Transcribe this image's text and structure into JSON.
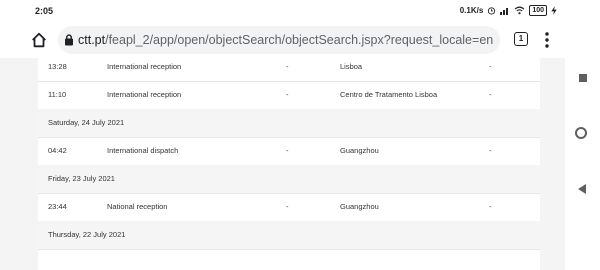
{
  "status_bar": {
    "time": "2:05",
    "net_speed": "0.1K/s",
    "battery": "100"
  },
  "browser": {
    "url_domain": "ctt.pt",
    "url_path": "/feapl_2/app/open/objectSearch/objectSearch.jspx?request_locale=en",
    "tab_count": "1"
  },
  "tracking": {
    "rows": [
      {
        "type": "event",
        "time": "13:28",
        "status": "International reception",
        "reason": "-",
        "local": "Lisboa",
        "obs": "-"
      },
      {
        "type": "event",
        "time": "11:10",
        "status": "International reception",
        "reason": "-",
        "local": "Centro de Tratamento Lisboa",
        "obs": "-"
      },
      {
        "type": "date",
        "label": "Saturday, 24 July 2021"
      },
      {
        "type": "event",
        "time": "04:42",
        "status": "International dispatch",
        "reason": "-",
        "local": "Guangzhou",
        "obs": "-"
      },
      {
        "type": "date",
        "label": "Friday, 23 July 2021"
      },
      {
        "type": "event",
        "time": "23:44",
        "status": "National reception",
        "reason": "-",
        "local": "Guangzhou",
        "obs": "-"
      },
      {
        "type": "date",
        "label": "Thursday, 22 July 2021"
      }
    ]
  }
}
